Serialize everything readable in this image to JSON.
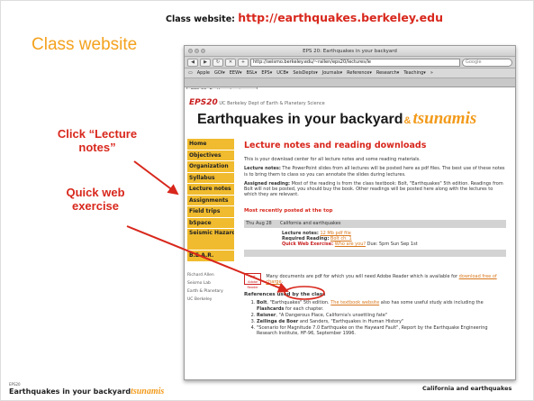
{
  "slide": {
    "header_prefix": "Class website: ",
    "header_url": "http://earthquakes.berkeley.edu",
    "title": "Class website",
    "annotation_click": "Click “Lecture notes”",
    "annotation_quick": "Quick web exercise",
    "footer_eps": "EPS20",
    "footer_title_main": "Earthquakes in your backyard",
    "footer_title_ts": "tsunamis",
    "footer_right": "California and earthquakes"
  },
  "browser": {
    "window_title": "EPS 20: Earthquakes in your backyard",
    "address": "http://seismo.berkeley.edu/~rallen/eps20/lectures/le",
    "search_placeholder": "Google",
    "bookmarks": [
      "Apple",
      "GOI▾",
      "EEW▾",
      "BSL▾",
      "EPS▾",
      "UCB▾",
      "SeisDepts▾",
      "Journals▾",
      "Reference▾",
      "Research▾",
      "Teaching▾",
      "»"
    ],
    "tab_label": "EPS 20: Earthquakes in you"
  },
  "site": {
    "eps_label": "EPS20",
    "dept_line": "UC Berkeley Dept of Earth & Planetary Science",
    "title_main": "Earthquakes in your backyard",
    "title_amp": "&",
    "title_ts": "tsunamis",
    "nav": [
      {
        "label": "Home"
      },
      {
        "label": "Objectives"
      },
      {
        "label": "Organization"
      },
      {
        "label": "Syllabus"
      },
      {
        "label": "Lecture notes"
      },
      {
        "label": "Assignments"
      },
      {
        "label": "Field trips"
      },
      {
        "label": "bSpace"
      },
      {
        "label": "Seismic Hazard Resources"
      },
      {
        "label": "B.E.A.R."
      }
    ],
    "side_info": [
      "Richard Allen",
      "Seismo Lab",
      "Earth & Planetary",
      "UC Berkeley"
    ]
  },
  "content": {
    "heading": "Lecture notes and reading downloads",
    "intro": "This is your download center for all lecture notes and some reading materials.",
    "lecture_label": "Lecture notes:",
    "lecture_text": " The PowerPoint slides from all lectures will be posted here as pdf files. The best use of these notes is to bring them to class so you can annotate the slides during lectures.",
    "reading_label": "Assigned reading:",
    "reading_text": " Most of the reading is from the class textbook: Bolt, \"Earthquakes\" 5th edition. Readings from Bolt will not be posted, you should buy the book. Other readings will be posted here along with the lectures to which they are relevant.",
    "recent": "Most recently posted at the top",
    "row_date": "Thu Aug 28",
    "row_title": "California and earthquakes",
    "lec_notes_label": "Lecture notes:",
    "lec_notes_link": "12 Mb pdf file",
    "req_reading_label": "Required Reading:",
    "req_reading_link": "Bolt ch. 1",
    "quick_label": "Quick Web Exercise:",
    "quick_link": "Who are you?",
    "quick_due": " Due: 5pm Sun Sep 1st",
    "reader_icon_text": "Get Adobe Reader",
    "reader_text_a": "Many documents are pdf for which you will need Adobe Reader which is available for ",
    "reader_link": "download free of charge",
    "reader_text_b": ".",
    "refs_title": "References used by the class",
    "refs": [
      {
        "a": "Bolt",
        "b": ", \"Earthquakes\" 5th edition. ",
        "link": "The textbook website",
        "c": " also has some useful study aids including the ",
        "d": "Flashcards",
        "e": " for each chapter."
      },
      {
        "a": "Reisner",
        "b": ", \"A Dangerous Place, California's unsettling fate\"",
        "link": "",
        "c": "",
        "d": "",
        "e": ""
      },
      {
        "a": "Zeilinga de Boer",
        "b": " and Sanders, \"Earthquakes in Human History\"",
        "link": "",
        "c": "",
        "d": "",
        "e": ""
      },
      {
        "a": "",
        "b": "\"Scenario for Magnitude 7.0 Earthquake on the Hayward Fault\", Report by the Earthquake Engineering Research Institute, HF-96, September 1996.",
        "link": "",
        "c": "",
        "d": "",
        "e": ""
      }
    ]
  },
  "colors": {
    "accent_red": "#d8271c",
    "accent_orange": "#f4a21e",
    "nav_yellow": "#f0bb2e"
  }
}
